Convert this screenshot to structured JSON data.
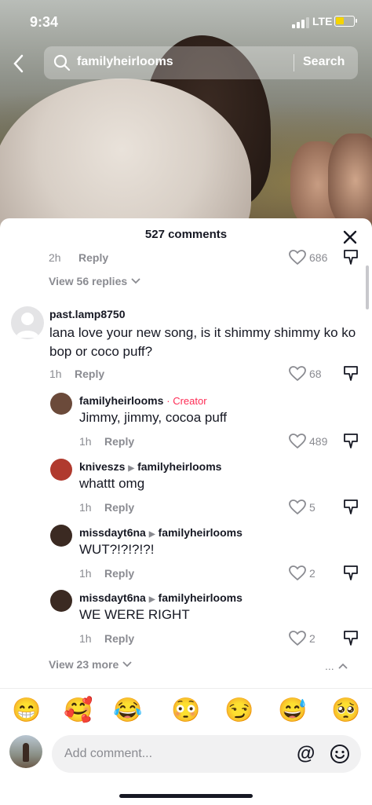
{
  "status_bar": {
    "time": "9:34",
    "network": "LTE"
  },
  "search": {
    "query": "familyheirlooms",
    "button_label": "Search"
  },
  "comments_panel": {
    "title": "527 comments",
    "partial_comment": {
      "time": "2h",
      "reply_label": "Reply",
      "likes": "686"
    },
    "view_replies_label": "View 56 replies",
    "main_comment": {
      "username": "past.lamp8750",
      "text": "lana love your new song, is it shimmy shimmy ko ko bop or coco puff?",
      "time": "1h",
      "reply_label": "Reply",
      "likes": "68"
    },
    "replies": [
      {
        "username": "familyheirlooms",
        "badge": "· Creator",
        "reply_to": "",
        "text": "Jimmy, jimmy, cocoa puff",
        "time": "1h",
        "reply_label": "Reply",
        "likes": "489",
        "avatar_color": "#6b4a3a"
      },
      {
        "username": "kniveszs",
        "badge": "",
        "reply_to": "familyheirlooms",
        "text": "whattt omg",
        "time": "1h",
        "reply_label": "Reply",
        "likes": "5",
        "avatar_color": "#b03a2e"
      },
      {
        "username": "missdayt6na",
        "badge": "",
        "reply_to": "familyheirlooms",
        "text": "WUT?!?!?!?!",
        "time": "1h",
        "reply_label": "Reply",
        "likes": "2",
        "avatar_color": "#3b2a22"
      },
      {
        "username": "missdayt6na",
        "badge": "",
        "reply_to": "familyheirlooms",
        "text": "WE WERE RIGHT",
        "time": "1h",
        "reply_label": "Reply",
        "likes": "2",
        "avatar_color": "#3b2a22"
      }
    ],
    "view_more_label": "View 23 more",
    "hide_label": "..."
  },
  "emoji_bar": [
    "😁",
    "🥰",
    "😂",
    "😳",
    "😏",
    "😅",
    "🥺"
  ],
  "comment_input": {
    "placeholder": "Add comment...",
    "mention_symbol": "@"
  }
}
